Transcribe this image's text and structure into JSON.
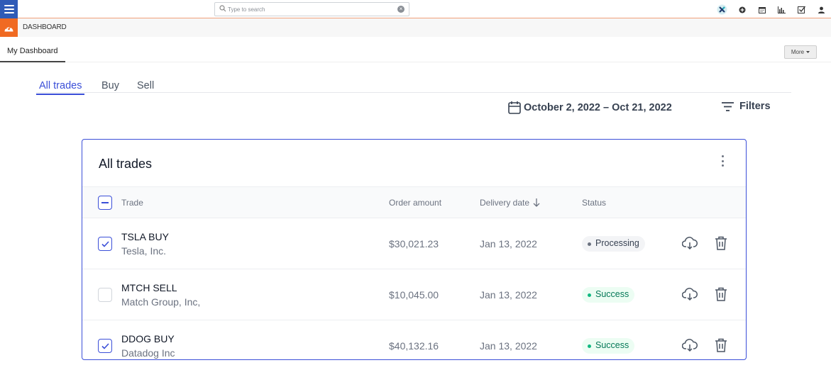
{
  "topbar": {
    "search_placeholder": "Type to search",
    "icons": [
      "menu-icon",
      "search-icon",
      "clear-icon",
      "app-x-icon",
      "plus-circle-icon",
      "calendar-icon",
      "bar-chart-icon",
      "checkbox-icon",
      "user-icon"
    ]
  },
  "dashboard_row": {
    "label": "DASHBOARD"
  },
  "my_tabs": {
    "my_dashboard": "My Dashboard",
    "more": "More"
  },
  "trade_tabs": [
    {
      "label": "All trades",
      "active": true
    },
    {
      "label": "Buy",
      "active": false
    },
    {
      "label": "Sell",
      "active": false
    }
  ],
  "date_range": "October 2, 2022 – Oct 21, 2022",
  "filters_label": "Filters",
  "card": {
    "title": "All trades",
    "columns": {
      "trade": "Trade",
      "order_amount": "Order amount",
      "delivery_date": "Delivery date",
      "status": "Status"
    },
    "rows": [
      {
        "trade": "TSLA BUY",
        "company": "Tesla, Inc.",
        "amount": "$30,021.23",
        "date": "Jan 13, 2022",
        "status": "Processing",
        "checked": true
      },
      {
        "trade": "MTCH SELL",
        "company": "Match Group, Inc,",
        "amount": "$10,045.00",
        "date": "Jan 13, 2022",
        "status": "Success",
        "checked": false
      },
      {
        "trade": "DDOG BUY",
        "company": "Datadog Inc",
        "amount": "$40,132.16",
        "date": "Jan 13, 2022",
        "status": "Success",
        "checked": true
      }
    ]
  },
  "colors": {
    "accent": "#3b4fd8",
    "brand_orange": "#f06a22",
    "menu_blue": "#2f5bb7",
    "success": "#047857"
  }
}
